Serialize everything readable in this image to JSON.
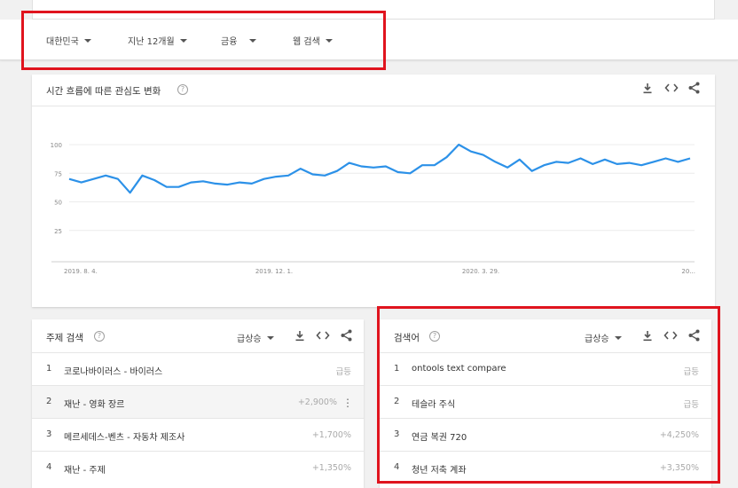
{
  "filters": {
    "region": "대한민국",
    "period": "지난 12개월",
    "category": "금융",
    "search_type": "웹 검색"
  },
  "interest_card": {
    "title": "시간 흐름에 따른 관심도 변화",
    "download_icon": "download-icon",
    "embed_icon": "embed-code-icon",
    "share_icon": "share-icon"
  },
  "chart_data": {
    "type": "line",
    "title": "시간 흐름에 따른 관심도 변화",
    "xlabel": "",
    "ylabel": "",
    "ylim": [
      0,
      100
    ],
    "yticks": [
      25,
      50,
      75,
      100
    ],
    "xtick_labels": [
      "2019. 8. 4.",
      "2019. 12. 1.",
      "2020. 3. 29.",
      "20..."
    ],
    "grid": true,
    "series": [
      {
        "color": "#2c91e8",
        "values": [
          70,
          67,
          70,
          73,
          70,
          58,
          73,
          69,
          63,
          63,
          67,
          68,
          66,
          65,
          67,
          66,
          70,
          72,
          73,
          79,
          74,
          73,
          77,
          84,
          81,
          80,
          81,
          76,
          75,
          82,
          82,
          89,
          100,
          94,
          91,
          85,
          80,
          87,
          77,
          82,
          85,
          84,
          88,
          83,
          87,
          83,
          84,
          82,
          85,
          88,
          85,
          88
        ]
      }
    ]
  },
  "topics_card": {
    "title": "주제 검색",
    "sort_label": "급상승",
    "rows": [
      {
        "idx": "1",
        "text": "코로나바이러스 - 바이러스",
        "value": "급등"
      },
      {
        "idx": "2",
        "text": "재난 - 영화 장르",
        "value": "+2,900%"
      },
      {
        "idx": "3",
        "text": "메르세데스-벤츠 - 자동차 제조사",
        "value": "+1,700%"
      },
      {
        "idx": "4",
        "text": "재난 - 주제",
        "value": "+1,350%"
      }
    ]
  },
  "queries_card": {
    "title": "검색어",
    "sort_label": "급상승",
    "rows": [
      {
        "idx": "1",
        "text": "ontools text compare",
        "value": "급등"
      },
      {
        "idx": "2",
        "text": "테슬라 주식",
        "value": "급등"
      },
      {
        "idx": "3",
        "text": "연금 복권 720",
        "value": "+4,250%"
      },
      {
        "idx": "4",
        "text": "청년 저축 계좌",
        "value": "+3,350%"
      }
    ]
  },
  "colors": {
    "highlight_box": "#e0141e",
    "line": "#2c91e8"
  }
}
